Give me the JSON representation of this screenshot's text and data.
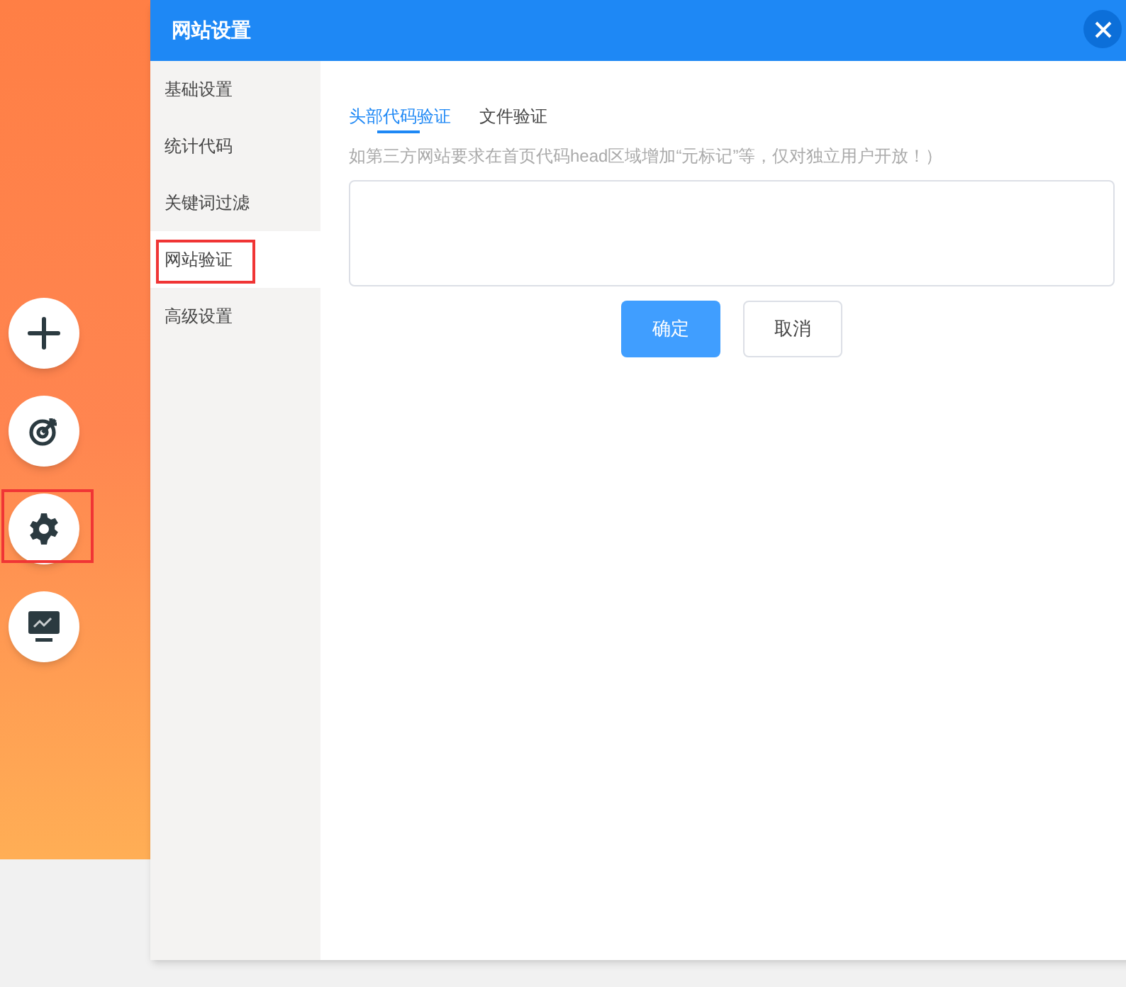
{
  "fabs": [
    {
      "kind": "plus",
      "annotated": false
    },
    {
      "kind": "target",
      "annotated": false
    },
    {
      "kind": "gear",
      "annotated": true
    },
    {
      "kind": "monitor",
      "annotated": false
    }
  ],
  "dialog": {
    "title": "网站设置",
    "sidebar": {
      "items": [
        {
          "label": "基础设置",
          "selected": false,
          "annotated": false
        },
        {
          "label": "统计代码",
          "selected": false,
          "annotated": false
        },
        {
          "label": "关键词过滤",
          "selected": false,
          "annotated": false
        },
        {
          "label": "网站验证",
          "selected": true,
          "annotated": true
        },
        {
          "label": "高级设置",
          "selected": false,
          "annotated": false
        }
      ]
    },
    "tabs": [
      {
        "label": "头部代码验证",
        "selected": true
      },
      {
        "label": "文件验证",
        "selected": false
      }
    ],
    "hint": "如第三方网站要求在首页代码head区域增加“元标记”等，仅对独立用户开放！）",
    "buttons": [
      {
        "label": "确定",
        "kind": "primary"
      },
      {
        "label": "取消",
        "kind": "default"
      }
    ]
  }
}
